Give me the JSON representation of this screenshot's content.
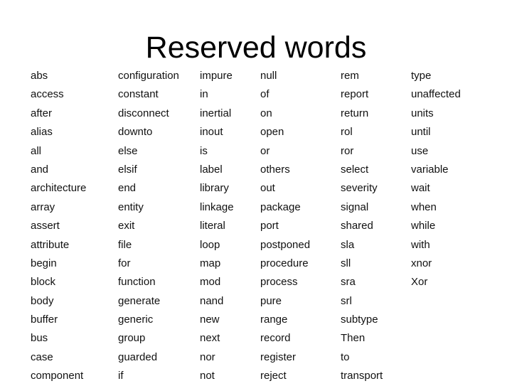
{
  "title": "Reserved words",
  "rows": [
    [
      "abs",
      "configuration",
      "impure",
      "null",
      "rem",
      "type"
    ],
    [
      "access",
      "constant",
      "in",
      "of",
      "report",
      "unaffected"
    ],
    [
      "after",
      "disconnect",
      "inertial",
      "on",
      "return",
      "units"
    ],
    [
      "alias",
      "downto",
      "inout",
      "open",
      "rol",
      "until"
    ],
    [
      "all",
      "else",
      "is",
      "or",
      "ror",
      "use"
    ],
    [
      "and",
      "elsif",
      "label",
      "others",
      "select",
      "variable"
    ],
    [
      "architecture",
      "end",
      "library",
      "out",
      "severity",
      "wait"
    ],
    [
      "array",
      "entity",
      "linkage",
      "package",
      "signal",
      "when"
    ],
    [
      "assert",
      "exit",
      "literal",
      "port",
      "shared",
      "while"
    ],
    [
      "attribute",
      "file",
      "loop",
      "postponed",
      "sla",
      "with"
    ],
    [
      "begin",
      "for",
      "map",
      "procedure",
      "sll",
      "xnor"
    ],
    [
      "block",
      "function",
      "mod",
      "process",
      "sra",
      "Xor"
    ],
    [
      "body",
      "generate",
      "nand",
      "pure",
      "srl",
      ""
    ],
    [
      "buffer",
      "generic",
      "new",
      "range",
      "subtype",
      ""
    ],
    [
      "bus",
      "group",
      "next",
      "record",
      "Then",
      ""
    ],
    [
      "case",
      "guarded",
      "nor",
      "register",
      "to",
      ""
    ],
    [
      "component",
      "if",
      "not",
      "reject",
      "transport",
      ""
    ]
  ]
}
